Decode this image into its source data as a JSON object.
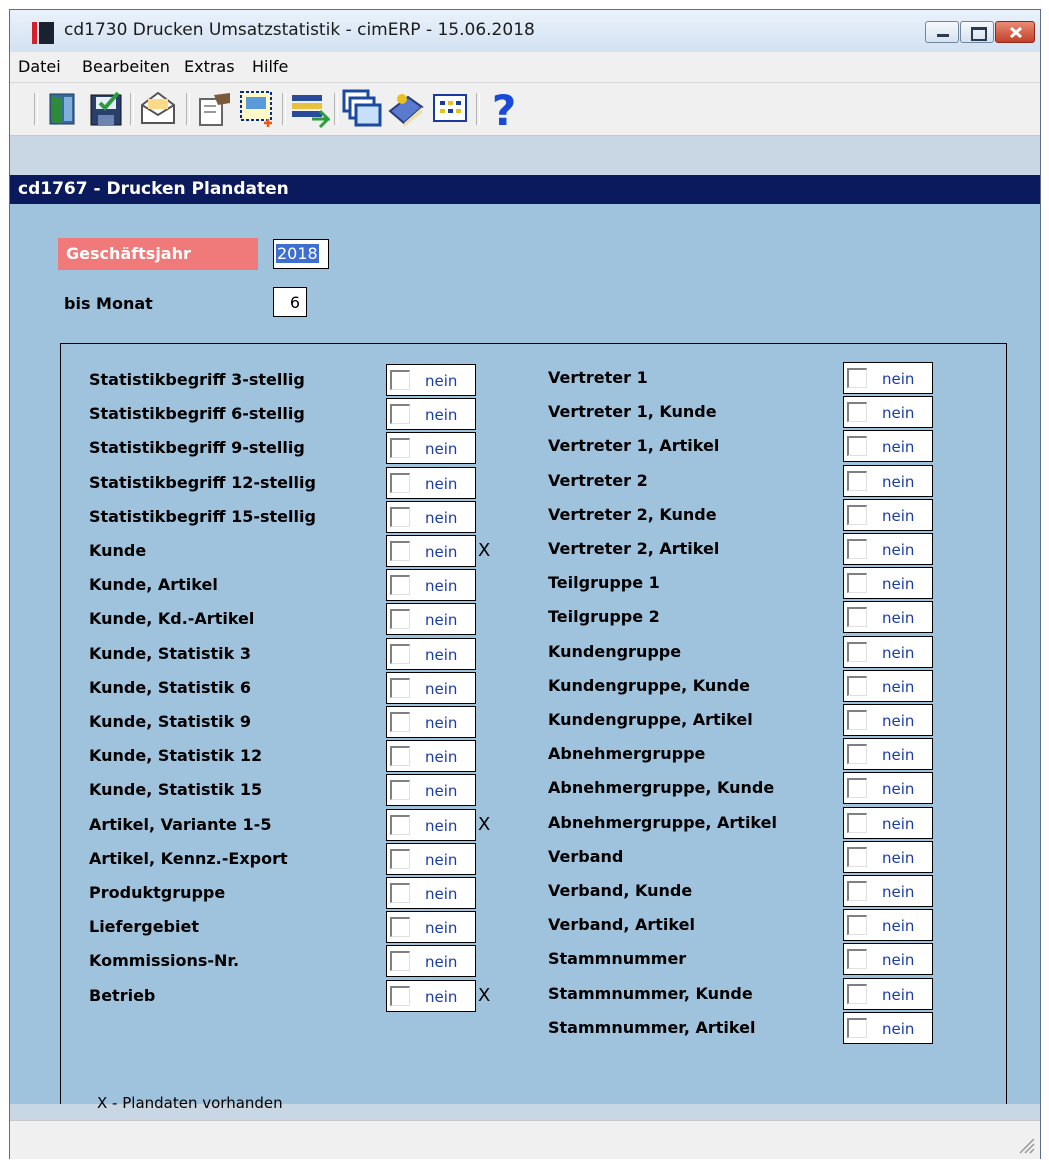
{
  "window": {
    "title": "cd1730 Drucken Umsatzstatistik - cimERP - 15.06.2018"
  },
  "menu": [
    {
      "label": "Datei"
    },
    {
      "label": "Bearbeiten"
    },
    {
      "label": "Extras"
    },
    {
      "label": "Hilfe"
    }
  ],
  "toolbar": [
    {
      "name": "exit-icon"
    },
    {
      "name": "save-icon"
    },
    {
      "name": "mail-icon"
    },
    {
      "name": "settings-icon"
    },
    {
      "name": "select-icon"
    },
    {
      "name": "list-icon"
    },
    {
      "name": "windows-icon"
    },
    {
      "name": "book-icon"
    },
    {
      "name": "grid-icon"
    },
    {
      "name": "help-icon"
    }
  ],
  "form": {
    "header": "cd1767 - Drucken Plandaten",
    "geschaeftsjahr": {
      "label": "Geschäftsjahr",
      "value": "2018"
    },
    "bis_monat": {
      "label": "bis Monat",
      "value": "6"
    },
    "checkbox_value": "nein",
    "legend": "X - Plandaten vorhanden",
    "left_items": [
      {
        "label": "Statistikbegriff 3-stellig",
        "value": "nein",
        "marked": false
      },
      {
        "label": "Statistikbegriff 6-stellig",
        "value": "nein",
        "marked": false
      },
      {
        "label": "Statistikbegriff 9-stellig",
        "value": "nein",
        "marked": false
      },
      {
        "label": "Statistikbegriff 12-stellig",
        "value": "nein",
        "marked": false
      },
      {
        "label": "Statistikbegriff 15-stellig",
        "value": "nein",
        "marked": false
      },
      {
        "label": "Kunde",
        "value": "nein",
        "marked": true
      },
      {
        "label": "Kunde, Artikel",
        "value": "nein",
        "marked": false
      },
      {
        "label": "Kunde, Kd.-Artikel",
        "value": "nein",
        "marked": false
      },
      {
        "label": "Kunde, Statistik 3",
        "value": "nein",
        "marked": false
      },
      {
        "label": "Kunde, Statistik 6",
        "value": "nein",
        "marked": false
      },
      {
        "label": "Kunde, Statistik 9",
        "value": "nein",
        "marked": false
      },
      {
        "label": "Kunde, Statistik 12",
        "value": "nein",
        "marked": false
      },
      {
        "label": "Kunde, Statistik 15",
        "value": "nein",
        "marked": false
      },
      {
        "label": "Artikel, Variante 1-5",
        "value": "nein",
        "marked": true
      },
      {
        "label": "Artikel, Kennz.-Export",
        "value": "nein",
        "marked": false
      },
      {
        "label": "Produktgruppe",
        "value": "nein",
        "marked": false
      },
      {
        "label": "Liefergebiet",
        "value": "nein",
        "marked": false
      },
      {
        "label": "Kommissions-Nr.",
        "value": "nein",
        "marked": false
      },
      {
        "label": "Betrieb",
        "value": "nein",
        "marked": true
      }
    ],
    "right_items": [
      {
        "label": "Vertreter 1",
        "value": "nein"
      },
      {
        "label": "Vertreter 1, Kunde",
        "value": "nein"
      },
      {
        "label": "Vertreter 1, Artikel",
        "value": "nein"
      },
      {
        "label": "Vertreter 2",
        "value": "nein"
      },
      {
        "label": "Vertreter 2, Kunde",
        "value": "nein"
      },
      {
        "label": "Vertreter 2, Artikel",
        "value": "nein"
      },
      {
        "label": "Teilgruppe 1",
        "value": "nein"
      },
      {
        "label": "Teilgruppe 2",
        "value": "nein"
      },
      {
        "label": "Kundengruppe",
        "value": "nein"
      },
      {
        "label": "Kundengruppe, Kunde",
        "value": "nein"
      },
      {
        "label": "Kundengruppe, Artikel",
        "value": "nein"
      },
      {
        "label": "Abnehmergruppe",
        "value": "nein"
      },
      {
        "label": "Abnehmergruppe, Kunde",
        "value": "nein"
      },
      {
        "label": "Abnehmergruppe, Artikel",
        "value": "nein"
      },
      {
        "label": "Verband",
        "value": "nein"
      },
      {
        "label": "Verband, Kunde",
        "value": "nein"
      },
      {
        "label": "Verband, Artikel",
        "value": "nein"
      },
      {
        "label": "Stammnummer",
        "value": "nein"
      },
      {
        "label": "Stammnummer, Kunde",
        "value": "nein"
      },
      {
        "label": "Stammnummer, Artikel",
        "value": "nein"
      }
    ],
    "mark_symbol": "X"
  },
  "colors": {
    "form_header": "#0a1a5c",
    "content_bg": "#9fc3dd",
    "required_label_bg": "#f07a7a",
    "checkbox_text": "#1a3ca6"
  }
}
